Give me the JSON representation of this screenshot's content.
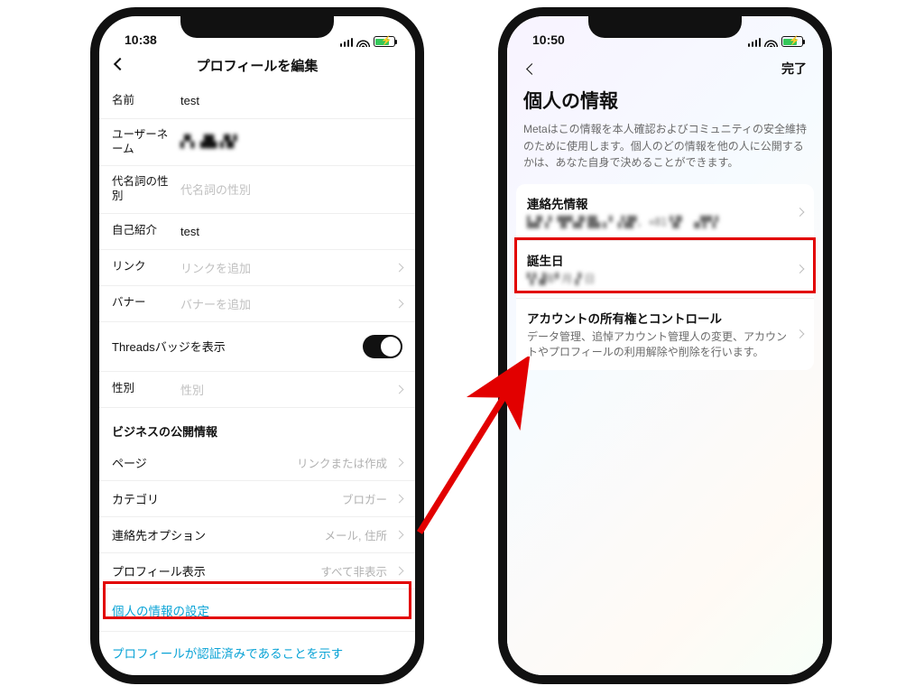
{
  "left": {
    "time": "10:38",
    "header_title": "プロフィールを編集",
    "rows": {
      "name_label": "名前",
      "name_value": "test",
      "username_label": "ユーザーネーム",
      "username_value": "▞▚ ▟█▖▞▙▘",
      "pronoun_label": "代名詞の性別",
      "pronoun_placeholder": "代名詞の性別",
      "bio_label": "自己紹介",
      "bio_value": "test",
      "links_label": "リンク",
      "links_placeholder": "リンクを追加",
      "banner_label": "バナー",
      "banner_placeholder": "バナーを追加",
      "threads_label": "Threadsバッジを表示",
      "gender_label": "性別",
      "gender_placeholder": "性別"
    },
    "business_section": "ビジネスの公開情報",
    "business": {
      "page_label": "ページ",
      "page_value": "リンクまたは作成",
      "category_label": "カテゴリ",
      "category_value": "ブロガー",
      "contact_label": "連絡先オプション",
      "contact_value": "メール, 住所",
      "display_label": "プロフィール表示",
      "display_value": "すべて非表示"
    },
    "link1": "個人の情報の設定",
    "link2": "プロフィールが認証済みであることを示す"
  },
  "right": {
    "time": "10:50",
    "done": "完了",
    "title": "個人の情報",
    "description": "Metaはこの情報を本人確認およびコミュニティの安全維持のために使用します。個人のどの情報を他の人に公開するかは、あなた自身で決めることができます。",
    "cards": {
      "contact_title": "連絡先情報",
      "contact_value": "▙▟▘▞ ▜▛▚▟▘█▙▗▝ ▞▟▛, +81▝▟▘ ▗▞▛▚▘",
      "birthday_title": "誕生日",
      "birthday_value": "▚▘▟年▘月▗▘日",
      "ownership_title": "アカウントの所有権とコントロール",
      "ownership_desc": "データ管理、追悼アカウント管理人の変更、アカウントやプロフィールの利用解除や削除を行います。"
    }
  }
}
